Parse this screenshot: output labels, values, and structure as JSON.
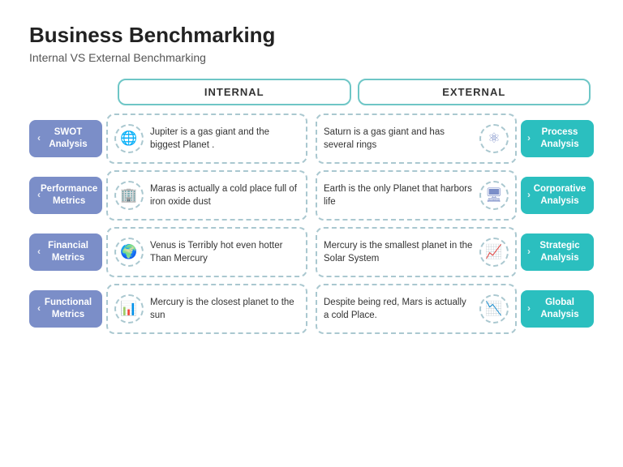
{
  "title": "Business Benchmarking",
  "subtitle": "Internal VS External Benchmarking",
  "headers": {
    "internal": "INTERNAL",
    "external": "EXTERNAL"
  },
  "rows": [
    {
      "left_label": "SWOT\nAnalysis",
      "internal_text": "Jupiter is a gas giant and the biggest Planet .",
      "internal_icon": "🌐",
      "external_text": "Saturn is a gas giant and has several rings",
      "external_icon": "⚛",
      "right_label": "Process\nAnalysis"
    },
    {
      "left_label": "Performance\nMetrics",
      "internal_text": "Maras is actually a cold place full of iron oxide dust",
      "internal_icon": "🏢",
      "external_text": "Earth is the only Planet that harbors life",
      "external_icon": "🖥",
      "right_label": "Corporative\nAnalysis"
    },
    {
      "left_label": "Financial\nMetrics",
      "internal_text": "Venus is Terribly hot even hotter Than Mercury",
      "internal_icon": "🌍",
      "external_text": "Mercury is the smallest planet in the Solar System",
      "external_icon": "📈",
      "right_label": "Strategic\nAnalysis"
    },
    {
      "left_label": "Functional\nMetrics",
      "internal_text": "Mercury is the closest planet to the sun",
      "internal_icon": "📊",
      "external_text": "Despite being red, Mars is actually a cold Place.",
      "external_icon": "📉",
      "right_label": "Global\nAnalysis"
    }
  ]
}
